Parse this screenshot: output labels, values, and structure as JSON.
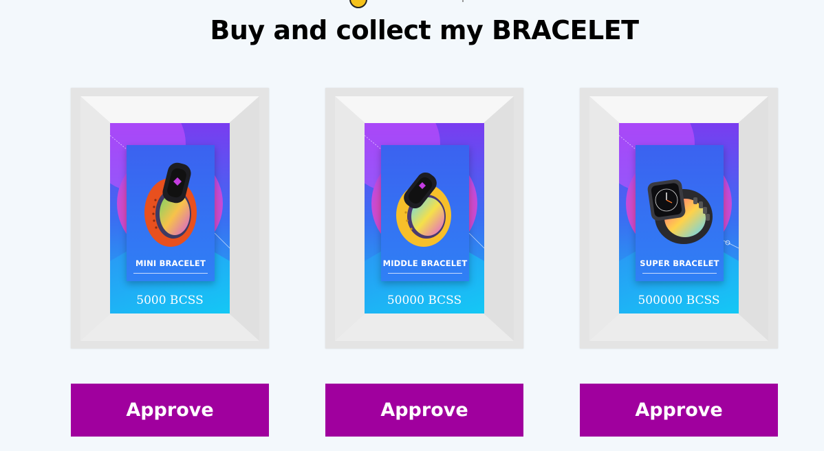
{
  "header": {
    "title": "Buy and collect my BRACELET"
  },
  "colors": {
    "background": "#f3f8fc",
    "approve_button": "#a0009e",
    "approve_text": "#ffffff"
  },
  "products": [
    {
      "name": "MINI BRACELET",
      "price": "5000 BCSS",
      "approve_label": "Approve",
      "band_color": "#e8501e",
      "icon": "fitness-band-icon"
    },
    {
      "name": "MIDDLE BRACELET",
      "price": "50000 BCSS",
      "approve_label": "Approve",
      "band_color": "#f7bf2a",
      "icon": "fitness-band-icon"
    },
    {
      "name": "SUPER BRACELET",
      "price": "500000 BCSS",
      "approve_label": "Approve",
      "band_color": "#2a2a2e",
      "icon": "smartwatch-icon"
    }
  ]
}
